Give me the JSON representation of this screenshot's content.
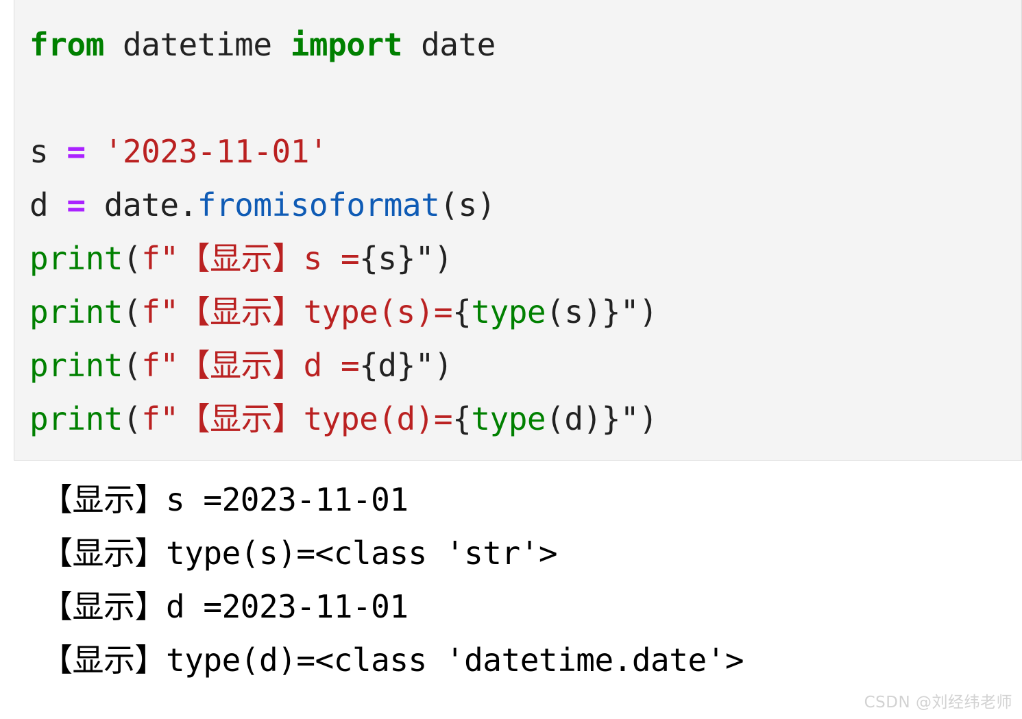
{
  "code_cell": {
    "language": "python",
    "background_color": "#f4f4f4",
    "border_color": "#dcdcdc",
    "colors": {
      "keyword": "#008000",
      "string": "#ba2121",
      "operator": "#aa22ff",
      "method": "#0f5bb5",
      "builtin": "#008000",
      "plain": "#222222"
    },
    "lines": [
      {
        "id": "line-1",
        "text": "from datetime import date",
        "tokens": [
          {
            "t": "from",
            "c": "kw"
          },
          {
            "t": " datetime ",
            "c": "plain"
          },
          {
            "t": "import",
            "c": "kw"
          },
          {
            "t": " date",
            "c": "plain"
          }
        ]
      },
      {
        "id": "line-2",
        "text": "",
        "tokens": []
      },
      {
        "id": "line-3",
        "text": "s = '2023-11-01'",
        "tokens": [
          {
            "t": "s ",
            "c": "plain"
          },
          {
            "t": "=",
            "c": "op"
          },
          {
            "t": " ",
            "c": "plain"
          },
          {
            "t": "'2023-11-01'",
            "c": "str"
          }
        ]
      },
      {
        "id": "line-4",
        "text": "d = date.fromisoformat(s)",
        "tokens": [
          {
            "t": "d ",
            "c": "plain"
          },
          {
            "t": "=",
            "c": "op"
          },
          {
            "t": " date.",
            "c": "plain"
          },
          {
            "t": "fromisoformat",
            "c": "fn"
          },
          {
            "t": "(s)",
            "c": "punct"
          }
        ]
      },
      {
        "id": "line-5",
        "text": "print(f\"【显示】s ={s}\")",
        "tokens": [
          {
            "t": "print",
            "c": "builtin"
          },
          {
            "t": "(",
            "c": "punct"
          },
          {
            "t": "f\"【显示】s =",
            "c": "str"
          },
          {
            "t": "{",
            "c": "punct"
          },
          {
            "t": "s",
            "c": "plain"
          },
          {
            "t": "}",
            "c": "punct"
          },
          {
            "t": "\"",
            "c": "punct"
          },
          {
            "t": ")",
            "c": "punct"
          }
        ]
      },
      {
        "id": "line-6",
        "text": "print(f\"【显示】type(s)={type(s)}\")",
        "tokens": [
          {
            "t": "print",
            "c": "builtin"
          },
          {
            "t": "(",
            "c": "punct"
          },
          {
            "t": "f\"【显示】type(s)=",
            "c": "str"
          },
          {
            "t": "{",
            "c": "punct"
          },
          {
            "t": "type",
            "c": "builtin"
          },
          {
            "t": "(s)",
            "c": "plain"
          },
          {
            "t": "}",
            "c": "punct"
          },
          {
            "t": "\"",
            "c": "punct"
          },
          {
            "t": ")",
            "c": "punct"
          }
        ]
      },
      {
        "id": "line-7",
        "text": "print(f\"【显示】d ={d}\")",
        "tokens": [
          {
            "t": "print",
            "c": "builtin"
          },
          {
            "t": "(",
            "c": "punct"
          },
          {
            "t": "f\"【显示】d =",
            "c": "str"
          },
          {
            "t": "{",
            "c": "punct"
          },
          {
            "t": "d",
            "c": "plain"
          },
          {
            "t": "}",
            "c": "punct"
          },
          {
            "t": "\"",
            "c": "punct"
          },
          {
            "t": ")",
            "c": "punct"
          }
        ]
      },
      {
        "id": "line-8",
        "text": "print(f\"【显示】type(d)={type(d)}\")",
        "tokens": [
          {
            "t": "print",
            "c": "builtin"
          },
          {
            "t": "(",
            "c": "punct"
          },
          {
            "t": "f\"【显示】type(d)=",
            "c": "str"
          },
          {
            "t": "{",
            "c": "punct"
          },
          {
            "t": "type",
            "c": "builtin"
          },
          {
            "t": "(d)",
            "c": "plain"
          },
          {
            "t": "}",
            "c": "punct"
          },
          {
            "t": "\"",
            "c": "punct"
          },
          {
            "t": ")",
            "c": "punct"
          }
        ]
      }
    ]
  },
  "output": {
    "text_color": "#000000",
    "background_color": "#ffffff",
    "lines": [
      {
        "id": "out-1",
        "text": "【显示】s =2023-11-01"
      },
      {
        "id": "out-2",
        "text": "【显示】type(s)=<class 'str'>"
      },
      {
        "id": "out-3",
        "text": "【显示】d =2023-11-01"
      },
      {
        "id": "out-4",
        "text": "【显示】type(d)=<class 'datetime.date'>"
      }
    ]
  },
  "watermark": {
    "text": "CSDN @刘经纬老师",
    "color": "#d2d2d2"
  }
}
